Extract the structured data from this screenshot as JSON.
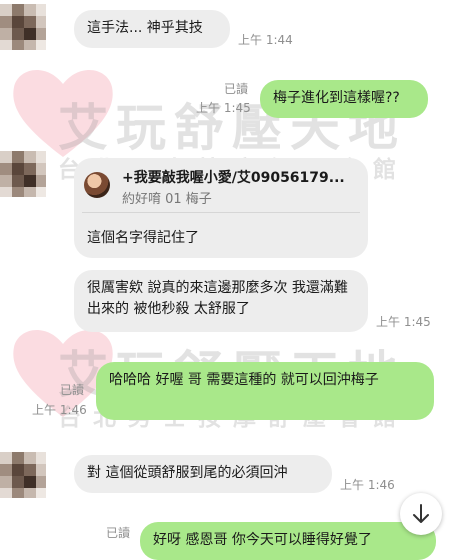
{
  "watermark": {
    "title": "艾玩舒壓天地",
    "subtitle": "台北男士按摩舒壓會館"
  },
  "messages": [
    {
      "side": "in",
      "text": "這手法... 神乎其技",
      "time": "上午 1:44"
    },
    {
      "side": "out",
      "text": "梅子進化到這樣喔??",
      "read": "已讀",
      "time": "上午 1:45"
    },
    {
      "side": "in",
      "card_title": "+我要敲我喔小愛/艾09056179...",
      "card_sub": "約好唷 01 梅子",
      "text": "這個名字得記住了"
    },
    {
      "side": "in",
      "text": "很厲害欸 說真的來這邊那麼多次 我還滿難出來的 被他秒殺 太舒服了",
      "time": "上午 1:45"
    },
    {
      "side": "out",
      "text": "哈哈哈 好喔 哥 需要這種的 就可以回沖梅子",
      "read": "已讀",
      "time": "上午 1:46"
    },
    {
      "side": "in",
      "text": "對 這個從頭舒服到尾的必須回沖",
      "time": "上午 1:46"
    },
    {
      "side": "out",
      "text": "好呀 感恩哥 你今天可以睡得好覺了",
      "read": "已讀"
    }
  ],
  "icons": {
    "scroll_down": "arrow-down-icon"
  },
  "colors": {
    "outgoing_bubble": "#a9e88a",
    "incoming_bubble": "#ededed",
    "meta_text": "#8f8f8f"
  }
}
